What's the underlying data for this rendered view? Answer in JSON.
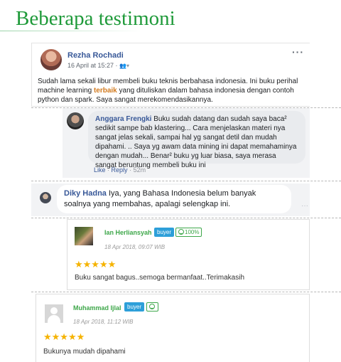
{
  "page": {
    "title": "Beberapa testimoni"
  },
  "post": {
    "author": "Rezha Rochadi",
    "date": "16 April at 15:27 ·",
    "audience_icon": "friends-icon",
    "more_label": "···",
    "text_before": "Sudah lama sekali libur membeli buku teknis berbahasa indonesia. Ini buku perihal machine learning ",
    "highlight": "terbaik",
    "text_after": " yang dituliskan dalam bahasa indonesia dengan contoh python dan spark. Saya sangat merekomendasikannya."
  },
  "comment1": {
    "author": "Anggara Frengki",
    "text": "Buku sudah datang dan sudah saya baca² sedikit sampe bab klastering... Cara menjelaskan materi nya sangat jelas sekali, sampai hal yg sangat detil dan mudah dipahami. .. Saya yg awam data mining ini dapat memahaminya dengan mudah... Benar² buku yg luar biasa, saya merasa sangat beruntung membeli buku ini",
    "like_label": "Like",
    "separator": "·",
    "reply_label": "Reply",
    "age": "52m"
  },
  "comment2": {
    "author": "Diky Hadna",
    "text": "Iya, yang Bahasa Indonesia belum banyak soalnya yang membahas, apalagi selengkap ini.",
    "more_label": "···"
  },
  "reviews": [
    {
      "author": "Ian Herliansyah",
      "badge": "buyer",
      "score": "100%",
      "date": "18 Apr 2018, 09:07 WIB",
      "stars": "★★★★★",
      "rating": 5,
      "text": "Buku sangat bagus..semoga bermanfaat..Terimakasih"
    },
    {
      "author": "Muhammad Ijlal",
      "badge": "buyer",
      "score": "",
      "date": "18 Apr 2018, 11:12 WIB",
      "stars": "★★★★★",
      "rating": 5,
      "text": "Bukunya mudah dipahami"
    }
  ],
  "colors": {
    "title": "#1f9a3a",
    "fb_link": "#385898",
    "highlight": "#d27a1e",
    "reviewer": "#3ea74a",
    "buyer_badge": "#2d9fd9",
    "star": "#f5b301"
  }
}
